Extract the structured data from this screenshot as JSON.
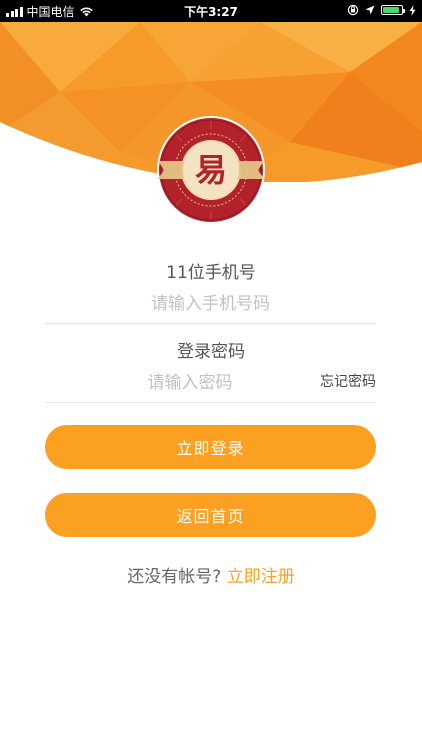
{
  "status_bar": {
    "carrier": "中国电信",
    "time": "下午3:27",
    "battery_percent": 90
  },
  "colors": {
    "accent": "#FBA021",
    "header_orange": "#F69A2A",
    "logo_red": "#B3222B",
    "logo_gold": "#E6C486"
  },
  "logo": {
    "character": "易"
  },
  "form": {
    "phone_label": "11位手机号",
    "phone_placeholder": "请输入手机号码",
    "password_label": "登录密码",
    "password_placeholder": "请输入密码",
    "forgot_password": "忘记密码"
  },
  "buttons": {
    "login": "立即登录",
    "back_home": "返回首页"
  },
  "register": {
    "prompt": "还没有帐号?",
    "link": "立即注册"
  },
  "icons": [
    "signal-icon",
    "wifi-icon",
    "orientation-lock-icon",
    "location-icon",
    "battery-icon",
    "charging-icon"
  ]
}
